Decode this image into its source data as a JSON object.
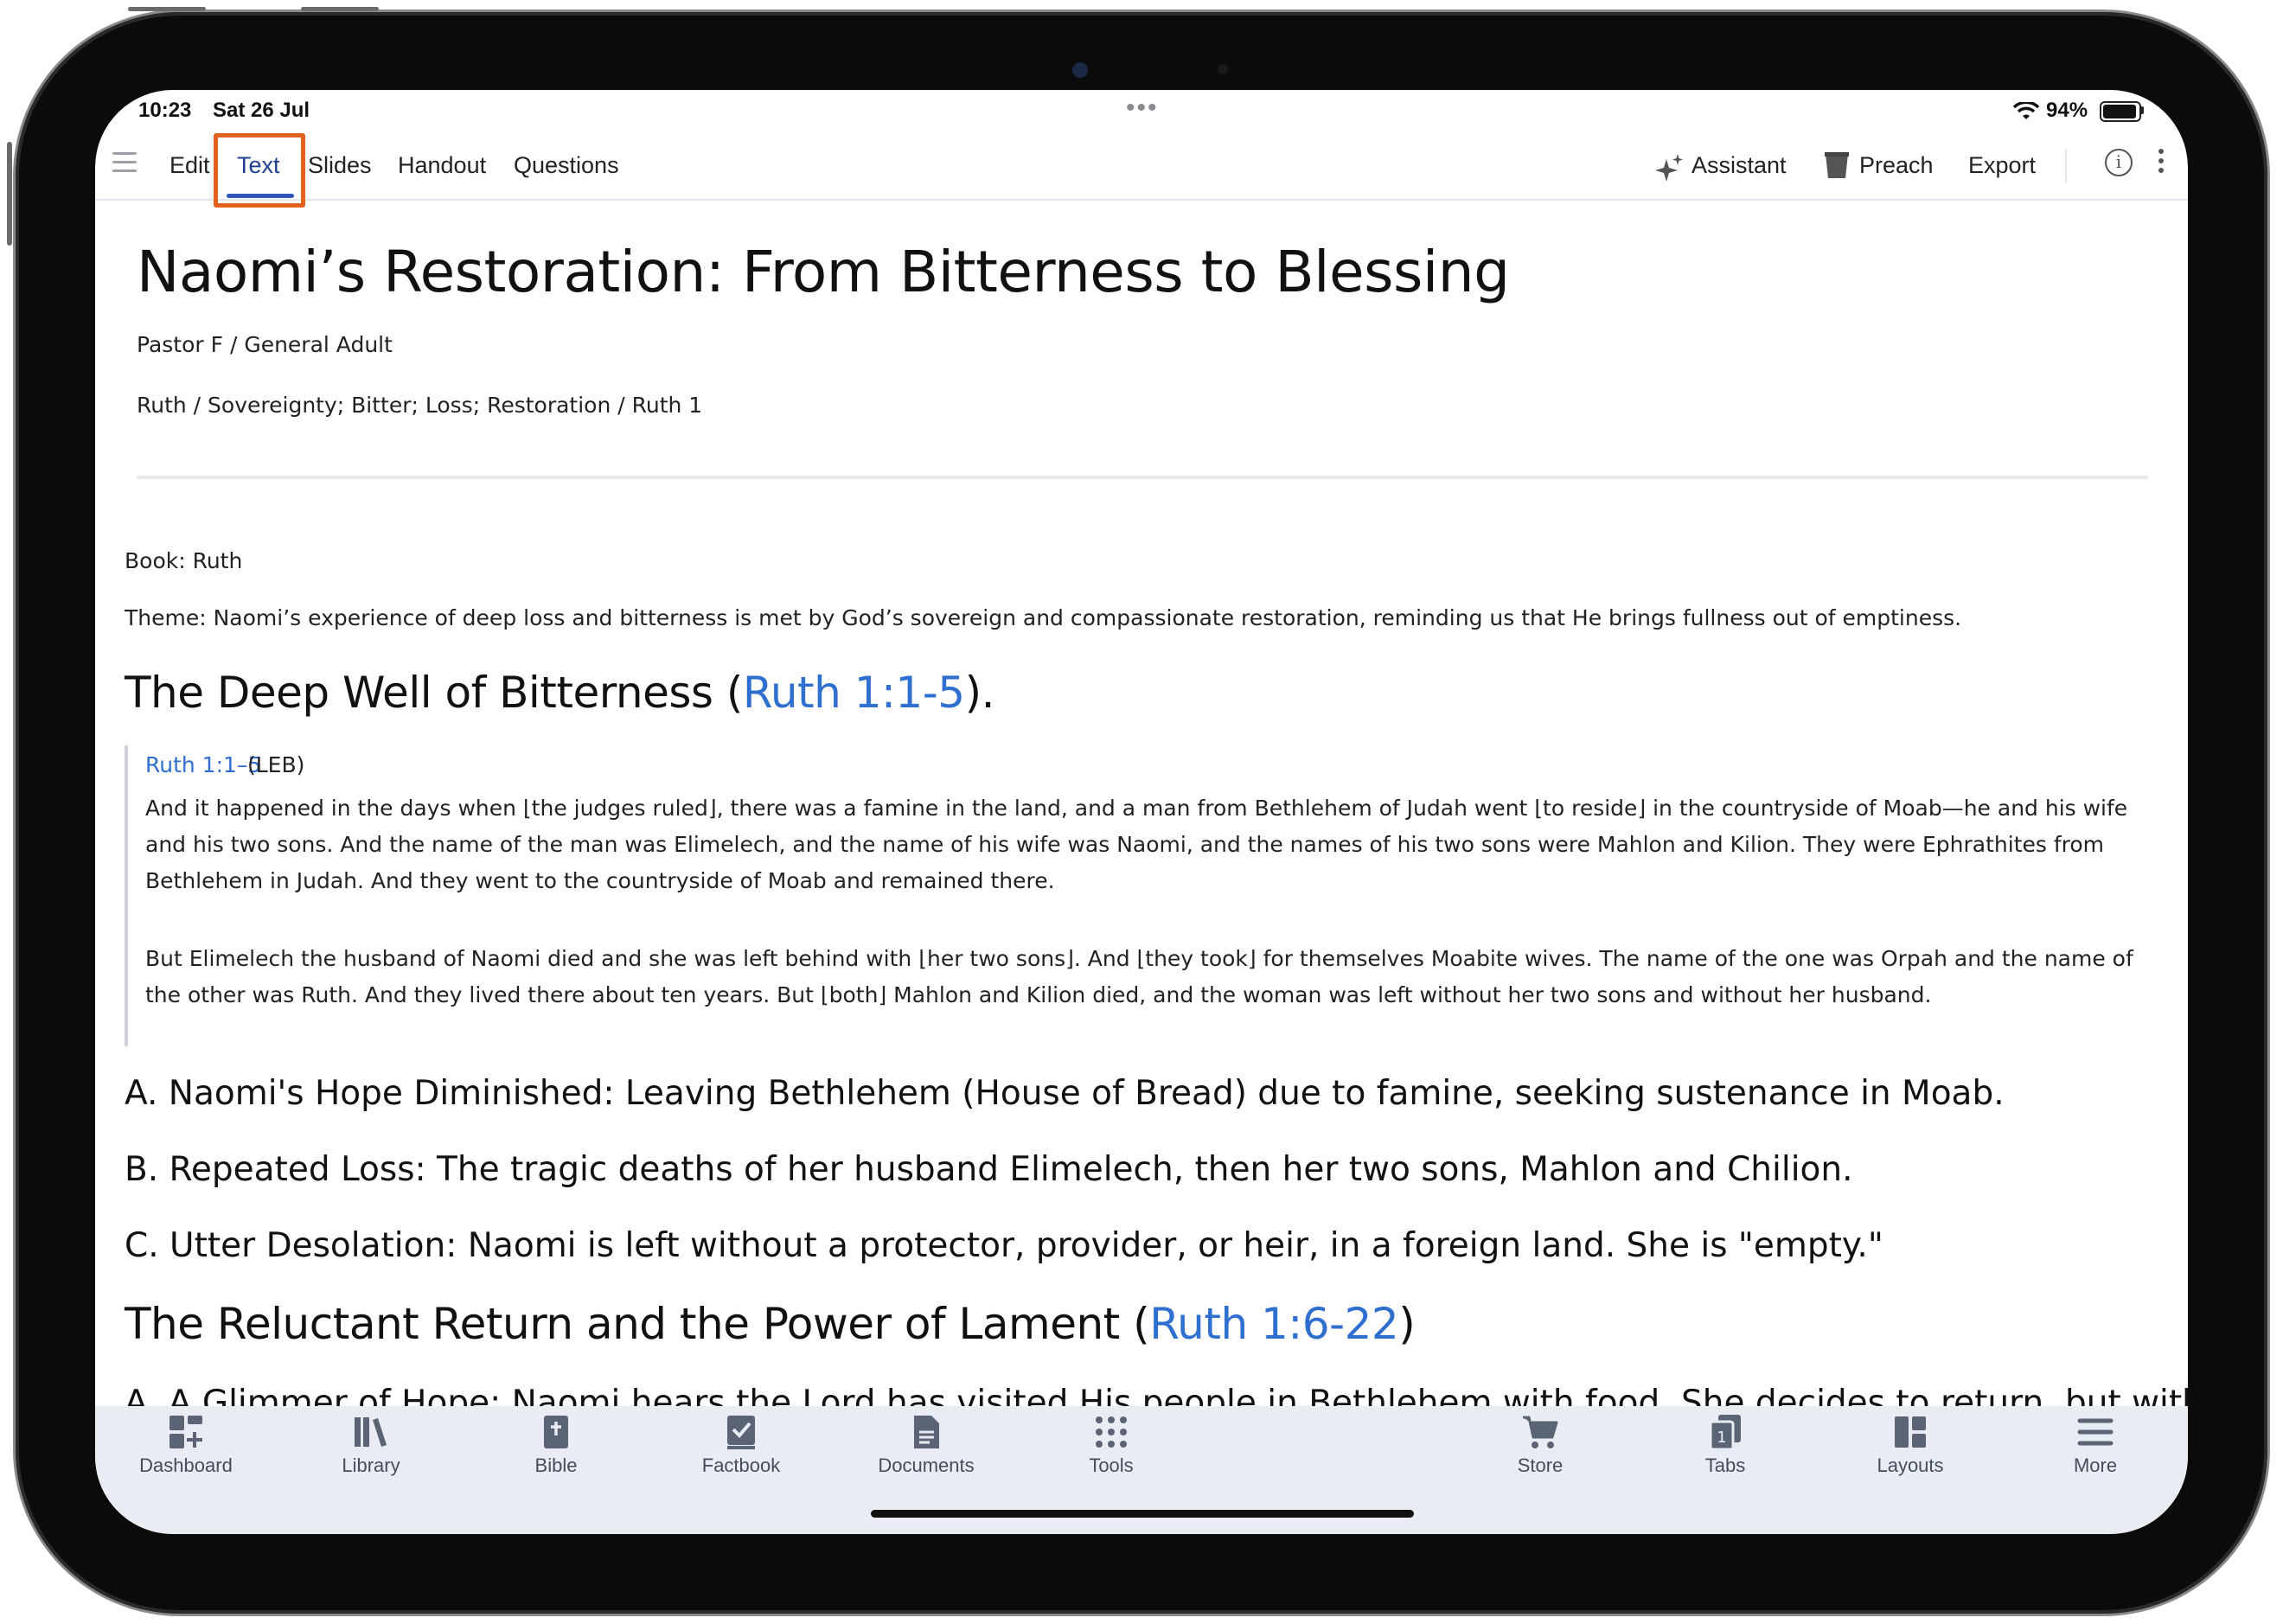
{
  "status": {
    "time": "10:23",
    "date": "Sat 26 Jul",
    "battery_pct": "94%",
    "battery_level": 0.94
  },
  "toolbar": {
    "tabs": [
      {
        "label": "Edit"
      },
      {
        "label": "Text"
      },
      {
        "label": "Slides"
      },
      {
        "label": "Handout"
      },
      {
        "label": "Questions"
      }
    ],
    "active_tab": "Text",
    "assistant": "Assistant",
    "preach": "Preach",
    "export": "Export"
  },
  "doc": {
    "title": "Naomi’s Restoration: From Bitterness to Blessing",
    "author_line": "Pastor F / General Adult",
    "topic_line": "Ruth / Sovereignty; Bitter; Loss; Restoration / Ruth 1",
    "book": "Book: Ruth",
    "theme": "Theme: Naomi’s experience of deep loss and bitterness is met by God’s sovereign and compassionate restoration, reminding us that He brings fullness out of emptiness.",
    "section1": {
      "title": "The Deep Well of Bitterness (",
      "ref": "Ruth 1:1-5",
      "end": ")."
    },
    "quote": {
      "ref": "Ruth 1:1–5",
      "version": "(LEB)",
      "p1": "And it happened in the days when ⌊the judges ruled⌋, there was a famine in the land, and a man from Bethlehem of Judah went ⌊to reside⌋ in the countryside of Moab—he and his wife and his two sons. And the name of the man was Elimelech, and the name of his wife was Naomi, and the names of his two sons were Mahlon and Kilion. They were Ephrathites from Bethlehem in Judah. And they went to the countryside of Moab and remained there.",
      "p2": "But Elimelech the husband of Naomi died and she was left behind with ⌊her two sons⌋. And ⌊they took⌋ for themselves Moabite wives. The name of the one was Orpah and the name of the other was Ruth. And they lived there about ten years. But ⌊both⌋ Mahlon and Kilion died, and the woman was left without her two sons and without her husband."
    },
    "points": [
      "A. Naomi's Hope Diminished: Leaving Bethlehem (House of Bread) due to famine, seeking sustenance in Moab.",
      "B. Repeated Loss: The tragic deaths of her husband Elimelech, then her two sons, Mahlon and Chilion.",
      "C. Utter Desolation: Naomi is left without a protector, provider, or heir, in a foreign land. She is \"empty.\""
    ],
    "section2": {
      "title": "The Reluctant Return and the Power of Lament (",
      "ref": "Ruth 1:6-22",
      "end": ")"
    },
    "cut_line": "A. A Glimmer of Hope: Naomi hears the Lord has visited His people in Bethlehem with food. She decides to return, but without"
  },
  "bottom_tabs": [
    {
      "label": "Dashboard",
      "icon": "dashboard-icon"
    },
    {
      "label": "Library",
      "icon": "library-icon"
    },
    {
      "label": "Bible",
      "icon": "bible-icon"
    },
    {
      "label": "Factbook",
      "icon": "factbook-icon"
    },
    {
      "label": "Documents",
      "icon": "documents-icon"
    },
    {
      "label": "Tools",
      "icon": "tools-icon"
    },
    {
      "label": "Store",
      "icon": "cart-icon"
    },
    {
      "label": "Tabs",
      "icon": "tabs-icon",
      "badge": "1"
    },
    {
      "label": "Layouts",
      "icon": "layouts-icon"
    },
    {
      "label": "More",
      "icon": "more-menu-icon"
    }
  ],
  "colors": {
    "accent": "#2f55b8",
    "link": "#2f6fcf",
    "highlight": "#e2611b",
    "tabbar_bg": "#e9ecf2"
  }
}
